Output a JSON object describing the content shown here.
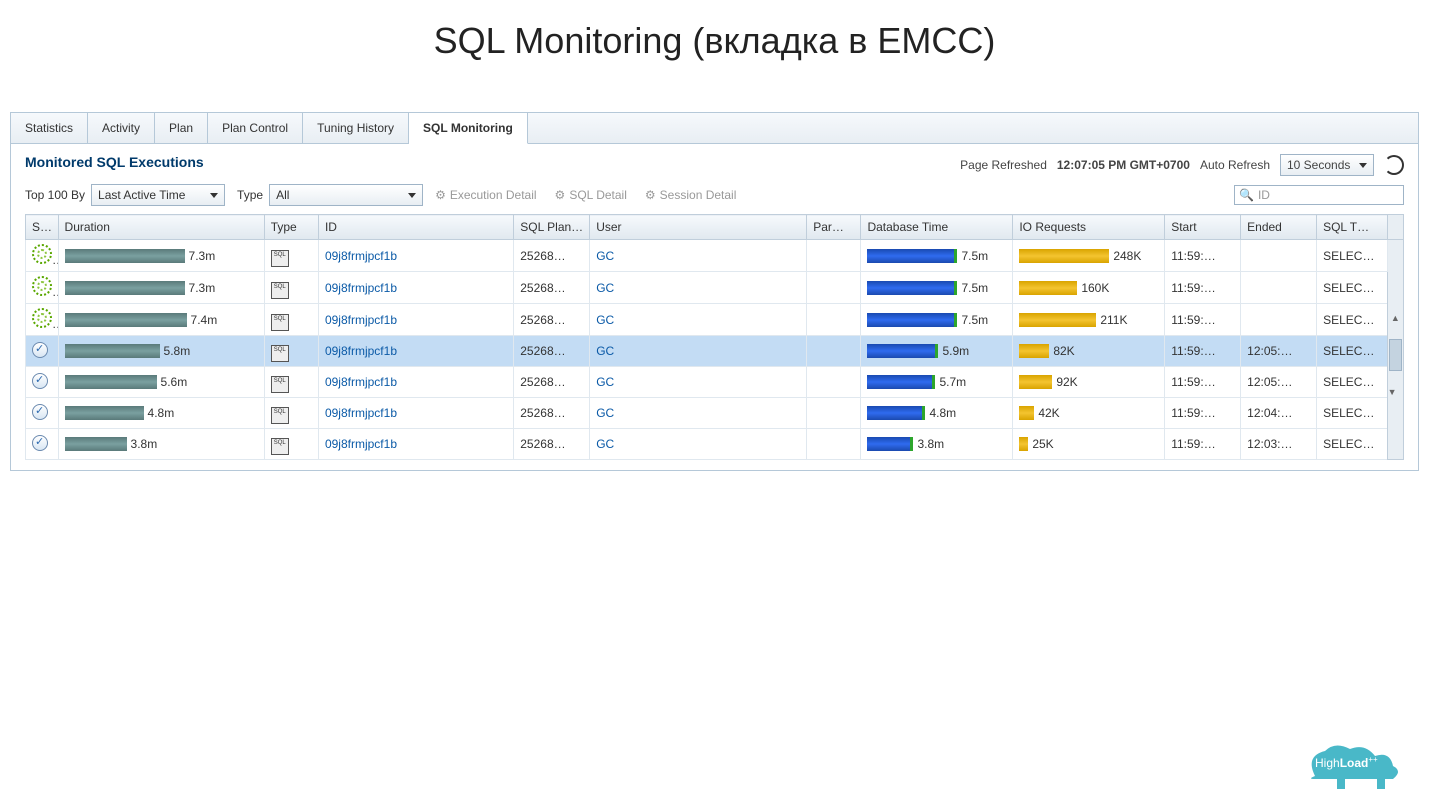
{
  "slide_title": "SQL Monitoring (вкладка в EMCC)",
  "tabs": [
    "Statistics",
    "Activity",
    "Plan",
    "Plan Control",
    "Tuning History",
    "SQL Monitoring"
  ],
  "active_tab": 5,
  "section_title": "Monitored SQL Executions",
  "page_refreshed_label": "Page Refreshed",
  "page_refreshed_time": "12:07:05 PM GMT+0700",
  "auto_refresh_label": "Auto Refresh",
  "auto_refresh_value": "10 Seconds",
  "top100_label": "Top 100 By",
  "top100_value": "Last Active Time",
  "type_label": "Type",
  "type_value": "All",
  "btn_exec": "Execution Detail",
  "btn_sql": "SQL Detail",
  "btn_session": "Session Detail",
  "search_placeholder": "ID",
  "columns": {
    "status": "S…",
    "duration": "Duration",
    "type": "Type",
    "id": "ID",
    "plan": "SQL Plan Hash",
    "user": "User",
    "par": "Par…",
    "dbtime": "Database Time",
    "io": "IO Requests",
    "start": "Start",
    "ended": "Ended",
    "sqlt": "SQL T…"
  },
  "rows": [
    {
      "status": "run",
      "dur_w": 120,
      "dur": "7.3m",
      "id": "09j8frmjpcf1b",
      "plan": "25268…",
      "user": "GC",
      "db_w": 90,
      "db": "7.5m",
      "io_w": 90,
      "io": "248K",
      "start": "11:59:…",
      "ended": "",
      "sqlt": "SELEC…"
    },
    {
      "status": "run",
      "dur_w": 120,
      "dur": "7.3m",
      "id": "09j8frmjpcf1b",
      "plan": "25268…",
      "user": "GC",
      "db_w": 90,
      "db": "7.5m",
      "io_w": 58,
      "io": "160K",
      "start": "11:59:…",
      "ended": "",
      "sqlt": "SELEC…"
    },
    {
      "status": "run",
      "dur_w": 122,
      "dur": "7.4m",
      "id": "09j8frmjpcf1b",
      "plan": "25268…",
      "user": "GC",
      "db_w": 90,
      "db": "7.5m",
      "io_w": 77,
      "io": "211K",
      "start": "11:59:…",
      "ended": "",
      "sqlt": "SELEC…"
    },
    {
      "status": "done",
      "sel": true,
      "dur_w": 95,
      "dur": "5.8m",
      "id": "09j8frmjpcf1b",
      "plan": "25268…",
      "user": "GC",
      "db_w": 71,
      "db": "5.9m",
      "io_w": 30,
      "io": "82K",
      "start": "11:59:…",
      "ended": "12:05:…",
      "sqlt": "SELEC…"
    },
    {
      "status": "done",
      "dur_w": 92,
      "dur": "5.6m",
      "id": "09j8frmjpcf1b",
      "plan": "25268…",
      "user": "GC",
      "db_w": 68,
      "db": "5.7m",
      "io_w": 33,
      "io": "92K",
      "start": "11:59:…",
      "ended": "12:05:…",
      "sqlt": "SELEC…"
    },
    {
      "status": "done",
      "dur_w": 79,
      "dur": "4.8m",
      "id": "09j8frmjpcf1b",
      "plan": "25268…",
      "user": "GC",
      "db_w": 58,
      "db": "4.8m",
      "io_w": 15,
      "io": "42K",
      "start": "11:59:…",
      "ended": "12:04:…",
      "sqlt": "SELEC…"
    },
    {
      "status": "done",
      "dur_w": 62,
      "dur": "3.8m",
      "id": "09j8frmjpcf1b",
      "plan": "25268…",
      "user": "GC",
      "db_w": 46,
      "db": "3.8m",
      "io_w": 9,
      "io": "25K",
      "start": "11:59:…",
      "ended": "12:03:…",
      "sqlt": "SELEC…"
    }
  ],
  "logo_text": "HighLoad"
}
